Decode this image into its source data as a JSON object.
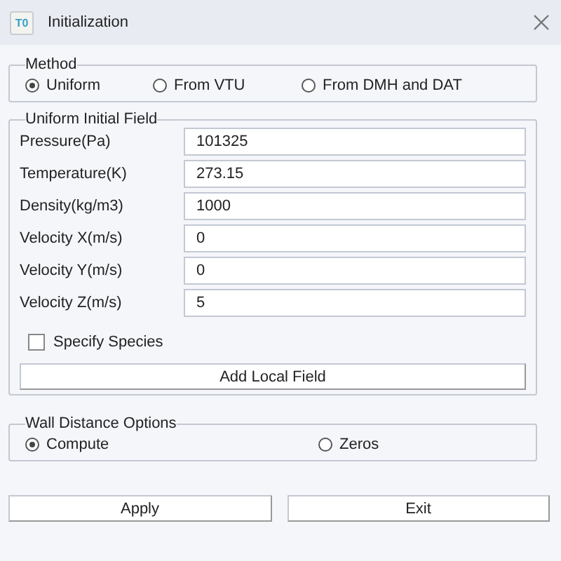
{
  "window": {
    "title": "Initialization",
    "app_icon": "T0"
  },
  "method": {
    "label": "Method",
    "options": [
      {
        "label": "Uniform",
        "selected": true
      },
      {
        "label": "From VTU",
        "selected": false
      },
      {
        "label": "From DMH and DAT",
        "selected": false
      }
    ]
  },
  "uniform_initial_field": {
    "label": "Uniform Initial Field",
    "fields": [
      {
        "label": "Pressure(Pa)",
        "value": "101325"
      },
      {
        "label": "Temperature(K)",
        "value": "273.15"
      },
      {
        "label": "Density(kg/m3)",
        "value": "1000"
      },
      {
        "label": "Velocity X(m/s)",
        "value": "0"
      },
      {
        "label": "Velocity Y(m/s)",
        "value": "0"
      },
      {
        "label": "Velocity Z(m/s)",
        "value": "5"
      }
    ],
    "specify_species": {
      "label": "Specify Species",
      "checked": false
    },
    "add_button": "Add Local Field"
  },
  "wall_distance": {
    "label": "Wall Distance Options",
    "options": [
      {
        "label": "Compute",
        "selected": true
      },
      {
        "label": "Zeros",
        "selected": false
      }
    ]
  },
  "buttons": [
    "Apply",
    "Exit"
  ]
}
